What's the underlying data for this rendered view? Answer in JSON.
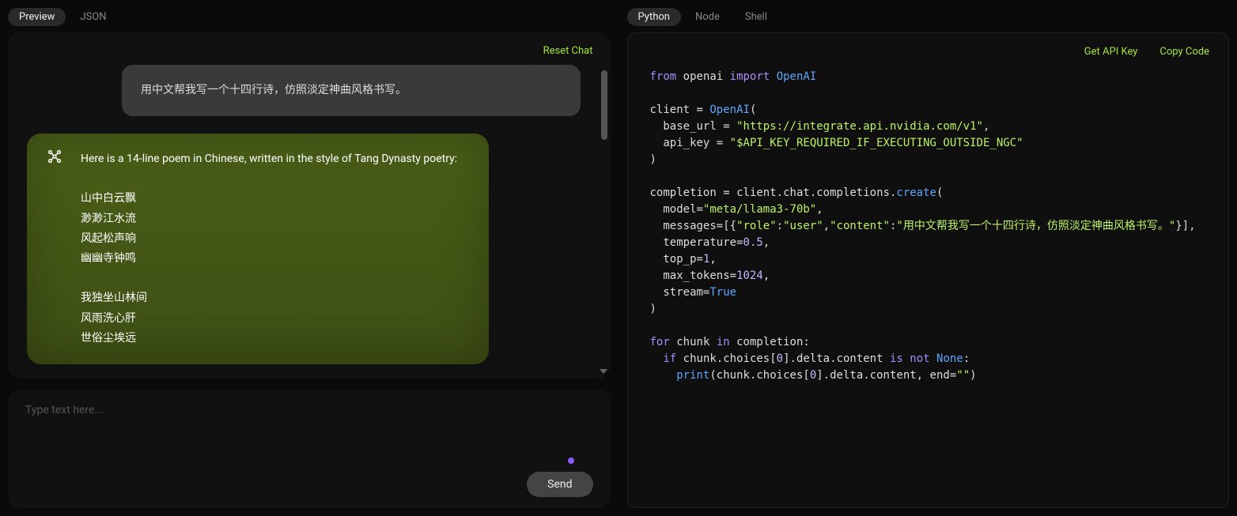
{
  "left": {
    "tabs": [
      {
        "id": "preview",
        "label": "Preview",
        "active": true
      },
      {
        "id": "json",
        "label": "JSON",
        "active": false
      }
    ],
    "reset_label": "Reset Chat",
    "user_message": "用中文帮我写一个十四行诗，仿照淡定神曲风格书写。",
    "ai_message": "Here is a 14-line poem in Chinese, written in the style of Tang Dynasty poetry:\n\n山中白云飘\n渺渺江水流\n风起松声响\n幽幽寺钟鸣\n\n我独坐山林间\n风雨洗心肝\n世俗尘埃远",
    "composer": {
      "placeholder": "Type text here...",
      "send_label": "Send"
    }
  },
  "right": {
    "tabs": [
      {
        "id": "python",
        "label": "Python",
        "active": true
      },
      {
        "id": "node",
        "label": "Node",
        "active": false
      },
      {
        "id": "shell",
        "label": "Shell",
        "active": false
      }
    ],
    "toolbar": {
      "get_api_key": "Get API Key",
      "copy_code": "Copy Code"
    },
    "code": {
      "kw_from": "from",
      "kw_import": "import",
      "mod_openai": "openai",
      "cls_openai": "OpenAI",
      "var_client": "client",
      "arg_base_url": "base_url",
      "val_base_url": "\"https://integrate.api.nvidia.com/v1\"",
      "arg_api_key": "api_key",
      "val_api_key": "\"$API_KEY_REQUIRED_IF_EXECUTING_OUTSIDE_NGC\"",
      "var_completion": "completion",
      "call_chain": "client.chat.completions.",
      "fn_create": "create",
      "arg_model": "model=",
      "val_model": "\"meta/llama3-70b\"",
      "arg_messages": "messages=[{",
      "key_role": "\"role\"",
      "val_role": "\"user\"",
      "key_content": "\"content\"",
      "val_content": "\"用中文帮我写一个十四行诗，仿照淡定神曲风格书写。\"",
      "arg_temperature": "temperature=",
      "val_temperature": "0.5",
      "arg_top_p": "top_p=",
      "val_top_p": "1",
      "arg_max_tokens": "max_tokens=",
      "val_max_tokens": "1024",
      "arg_stream": "stream=",
      "val_stream": "True",
      "kw_for": "for",
      "var_chunk": "chunk",
      "kw_in": "in",
      "kw_if": "if",
      "expr_choices0": "chunk.choices[",
      "num_zero": "0",
      "expr_delta": "].delta.content",
      "kw_is": "is",
      "kw_not": "not",
      "val_none": "None",
      "fn_print": "print",
      "expr_print_arg": "(chunk.choices[",
      "expr_print_tail": "].delta.content, end=",
      "val_empty": "\"\"",
      "paren_close": ")"
    }
  }
}
